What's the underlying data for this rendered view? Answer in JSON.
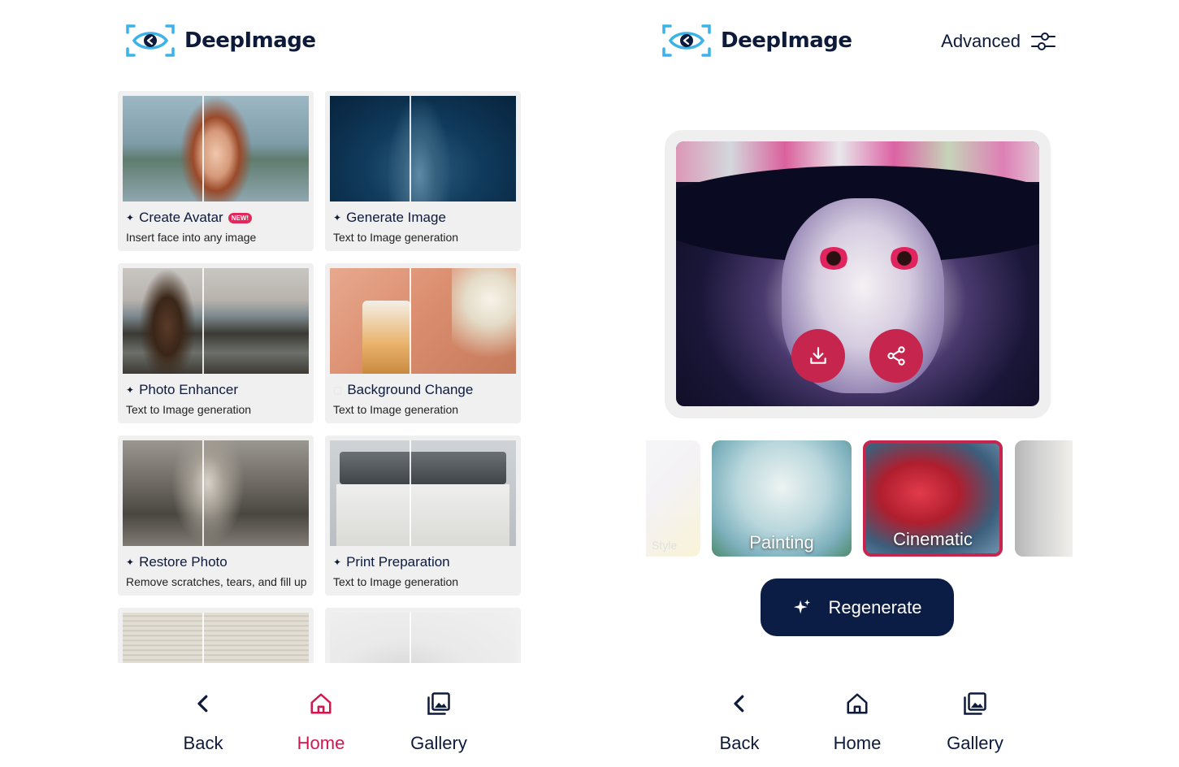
{
  "brand": {
    "name": "DeepImage",
    "accent": "#3bb2e8",
    "navy": "#0d1a3a",
    "pink": "#d4164f"
  },
  "left_screen": {
    "cards": [
      {
        "title": "Create Avatar",
        "badge": "NEW!",
        "subtitle": "Insert face into any image",
        "icon": "sparkle-icon"
      },
      {
        "title": "Generate Image",
        "subtitle": "Text to Image generation",
        "icon": "sparkle-icon"
      },
      {
        "title": "Photo Enhancer",
        "subtitle": "Text to Image generation",
        "icon": "sparkle-icon"
      },
      {
        "title": "Background Change",
        "subtitle": "Text to Image generation",
        "icon": "blank-icon"
      },
      {
        "title": "Restore Photo",
        "subtitle": "Remove scratches, tears, and fill up",
        "icon": "sparkle-icon"
      },
      {
        "title": "Print Preparation",
        "subtitle": "Text to Image generation",
        "icon": "sparkle-icon"
      }
    ],
    "nav": {
      "back": "Back",
      "home": "Home",
      "gallery": "Gallery",
      "active": "home"
    }
  },
  "right_screen": {
    "advanced_label": "Advanced",
    "styles": [
      {
        "label": "Style",
        "state": "faded"
      },
      {
        "label": "Painting",
        "state": "normal"
      },
      {
        "label": "Cinematic",
        "state": "selected"
      },
      {
        "label": "",
        "state": "faded"
      }
    ],
    "regenerate_label": "Regenerate",
    "nav": {
      "back": "Back",
      "home": "Home",
      "gallery": "Gallery",
      "active": "none"
    }
  }
}
